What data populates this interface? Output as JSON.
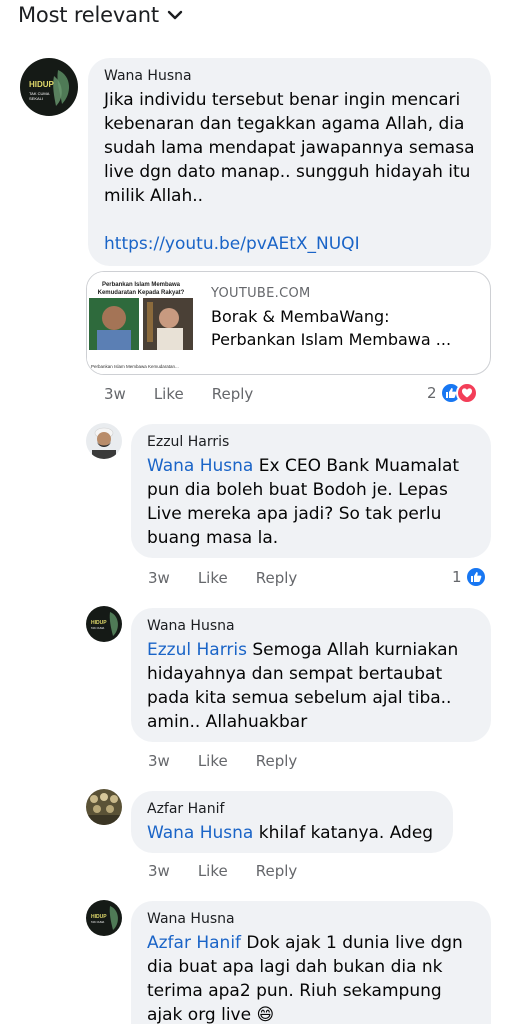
{
  "sort": {
    "label": "Most relevant"
  },
  "comments": [
    {
      "author": "Wana Husna",
      "avatar_text": "HIDUP TAK CUMA SEKALI",
      "text": "Jika individu tersebut benar ingin mencari kebenaran dan tegakkan agama Allah, dia sudah lama mendapat jawapannya semasa live dgn dato manap.. sungguh hidayah itu milik Allah..",
      "link": "https://youtu.be/pvAEtX_NUQI",
      "time": "3w",
      "like": "Like",
      "reply": "Reply",
      "reaction_count": "2"
    },
    {
      "author": "Ezzul Harris",
      "mention": "Wana Husna",
      "text": " Ex CEO Bank Muamalat pun dia boleh buat Bodoh je. Lepas Live mereka apa jadi? So tak perlu buang masa la.",
      "time": "3w",
      "like": "Like",
      "reply": "Reply",
      "reaction_count": "1"
    },
    {
      "author": "Wana Husna",
      "mention": "Ezzul Harris",
      "text": " Semoga Allah kurniakan hidayahnya dan sempat bertaubat pada kita semua sebelum ajal tiba.. amin.. Allahuakbar",
      "time": "3w",
      "like": "Like",
      "reply": "Reply"
    },
    {
      "author": "Azfar Hanif",
      "mention": "Wana Husna",
      "text": " khilaf katanya. Adeg",
      "time": "3w",
      "like": "Like",
      "reply": "Reply"
    },
    {
      "author": "Wana Husna",
      "mention": "Azfar Hanif",
      "text": " Dok ajak 1 dunia live dgn dia buat apa lagi dah bukan dia nk terima apa2 pun.  Riuh sekampung ajak org live ",
      "emoji": "😄"
    }
  ],
  "link_preview": {
    "domain": "YOUTUBE.COM",
    "title_line1": "Borak & MembaWang:",
    "title_line2": "Perbankan Islam Membawa ...",
    "thumb_caption": "Perbankan Islam Membawa Kemudaratan Kepada Rakyat?"
  },
  "colors": {
    "link": "#1a64c7",
    "bubble": "#f0f2f5",
    "like_blue": "#1877f2",
    "love_red": "#f33e58"
  }
}
